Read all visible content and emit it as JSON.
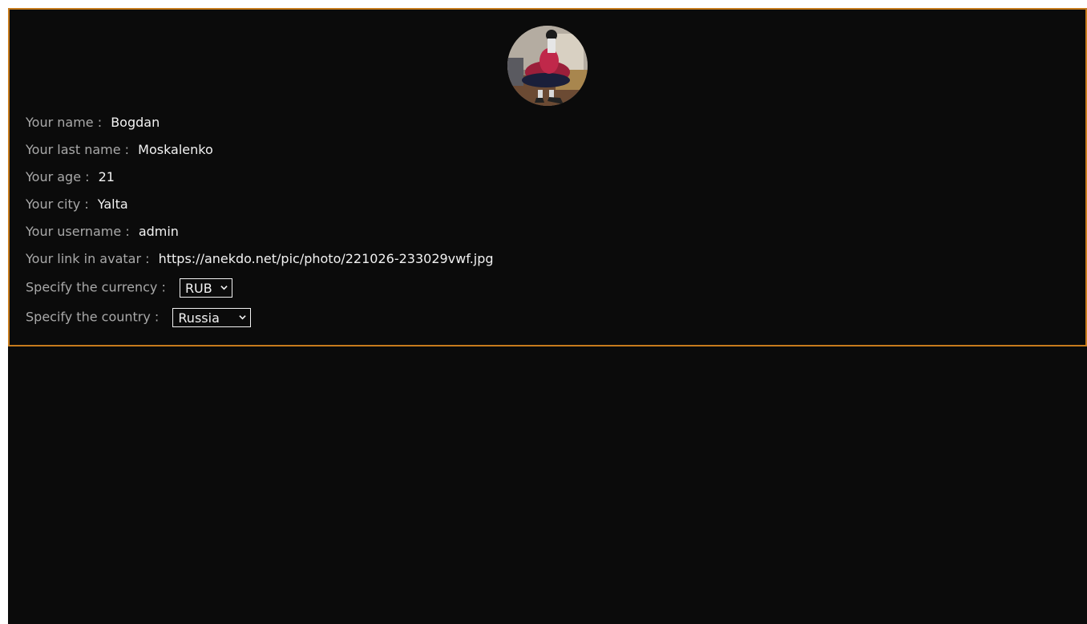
{
  "profile": {
    "fields": [
      {
        "label": "Your name :",
        "value": "Bogdan"
      },
      {
        "label": "Your last name :",
        "value": "Moskalenko"
      },
      {
        "label": "Your age :",
        "value": "21"
      },
      {
        "label": "Your city :",
        "value": "Yalta"
      },
      {
        "label": "Your username :",
        "value": "admin"
      },
      {
        "label": "Your link in avatar :",
        "value": "https://anekdo.net/pic/photo/221026-233029vwf.jpg"
      }
    ],
    "currency": {
      "label": "Specify the currency :",
      "selected": "RUB"
    },
    "country": {
      "label": "Specify the country :",
      "selected": "Russia"
    }
  },
  "colors": {
    "background": "#0b0b0b",
    "border": "#c67b1d",
    "label": "#a9a9a9",
    "value": "#f2f2f2"
  }
}
